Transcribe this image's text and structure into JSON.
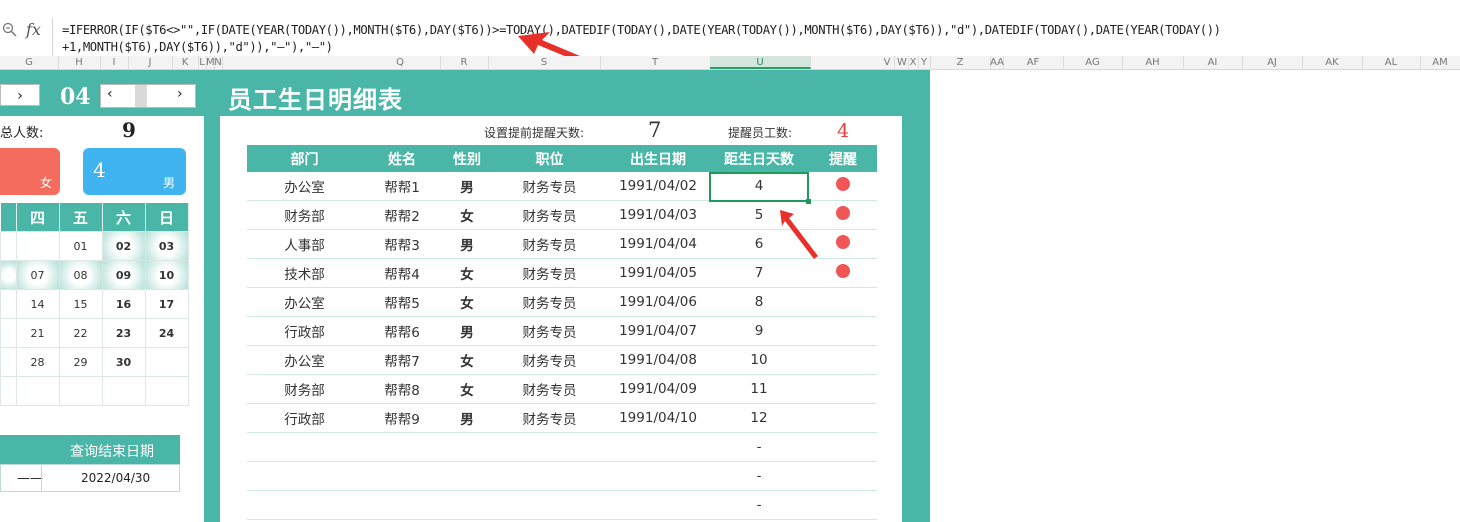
{
  "formula": {
    "line1": "=IFERROR(IF($T6<>\"\",IF(DATE(YEAR(TODAY()),MONTH($T6),DAY($T6))>=TODAY(),DATEDIF(TODAY(),DATE(YEAR(TODAY()),MONTH($T6),DAY($T6)),\"d\"),DATEDIF(TODAY(),DATE(YEAR(TODAY())",
    "line2": "+1,MONTH($T6),DAY($T6)),\"d\")),\"—\"),\"—\")",
    "fx": "fx"
  },
  "columns": [
    "G",
    "H",
    "I",
    "J",
    "K",
    "L",
    "M",
    "N",
    "Q",
    "R",
    "S",
    "T",
    "U",
    "V",
    "W",
    "X",
    "Y",
    "Z",
    "AA",
    "AF",
    "AG",
    "AH",
    "AI",
    "AJ",
    "AK",
    "AL",
    "AM"
  ],
  "selected_column": "U",
  "month": "04",
  "title": "员工生日明细表",
  "summary": {
    "total_label": "总人数:",
    "total_value": "9",
    "female_suffix": "女",
    "male_value": "4",
    "male_suffix": "男"
  },
  "calendar": {
    "weekdays": [
      "四",
      "五",
      "六",
      "日"
    ],
    "rows": [
      [
        "",
        "01",
        "02",
        "03"
      ],
      [
        "07",
        "08",
        "09",
        "10"
      ],
      [
        "14",
        "15",
        "16",
        "17"
      ],
      [
        "21",
        "22",
        "23",
        "24"
      ],
      [
        "28",
        "29",
        "30",
        ""
      ],
      [
        "",
        "",
        "",
        ""
      ]
    ]
  },
  "query": {
    "end_label": "查询结束日期",
    "left_value": "——",
    "end_value": "2022/04/30"
  },
  "settings": {
    "advance_label": "设置提前提醒天数:",
    "advance_value": "7",
    "remind_label": "提醒员工数:",
    "remind_value": "4"
  },
  "table": {
    "headers": [
      "部门",
      "姓名",
      "性别",
      "职位",
      "出生日期",
      "距生日天数",
      "提醒"
    ],
    "rows": [
      {
        "dept": "办公室",
        "name": "帮帮1",
        "gender": "男",
        "pos": "财务专员",
        "birth": "1991/04/02",
        "days": "4",
        "remind": true
      },
      {
        "dept": "财务部",
        "name": "帮帮2",
        "gender": "女",
        "pos": "财务专员",
        "birth": "1991/04/03",
        "days": "5",
        "remind": true
      },
      {
        "dept": "人事部",
        "name": "帮帮3",
        "gender": "男",
        "pos": "财务专员",
        "birth": "1991/04/04",
        "days": "6",
        "remind": true
      },
      {
        "dept": "技术部",
        "name": "帮帮4",
        "gender": "女",
        "pos": "财务专员",
        "birth": "1991/04/05",
        "days": "7",
        "remind": true
      },
      {
        "dept": "办公室",
        "name": "帮帮5",
        "gender": "女",
        "pos": "财务专员",
        "birth": "1991/04/06",
        "days": "8",
        "remind": false
      },
      {
        "dept": "行政部",
        "name": "帮帮6",
        "gender": "男",
        "pos": "财务专员",
        "birth": "1991/04/07",
        "days": "9",
        "remind": false
      },
      {
        "dept": "办公室",
        "name": "帮帮7",
        "gender": "女",
        "pos": "财务专员",
        "birth": "1991/04/08",
        "days": "10",
        "remind": false
      },
      {
        "dept": "财务部",
        "name": "帮帮8",
        "gender": "女",
        "pos": "财务专员",
        "birth": "1991/04/09",
        "days": "11",
        "remind": false
      },
      {
        "dept": "行政部",
        "name": "帮帮9",
        "gender": "男",
        "pos": "财务专员",
        "birth": "1991/04/10",
        "days": "12",
        "remind": false
      },
      {
        "dept": "",
        "name": "",
        "gender": "",
        "pos": "",
        "birth": "",
        "days": "-",
        "remind": false
      },
      {
        "dept": "",
        "name": "",
        "gender": "",
        "pos": "",
        "birth": "",
        "days": "-",
        "remind": false
      },
      {
        "dept": "",
        "name": "",
        "gender": "",
        "pos": "",
        "birth": "",
        "days": "-",
        "remind": false
      }
    ]
  },
  "colors": {
    "teal": "#49b6a7",
    "male_blue": "#2aa3d8",
    "female_red": "#e33c3c",
    "remind_dot": "#f05656",
    "arrow_red": "#e8302a",
    "female_card": "#f36c5d",
    "male_card": "#3fb4f0"
  }
}
